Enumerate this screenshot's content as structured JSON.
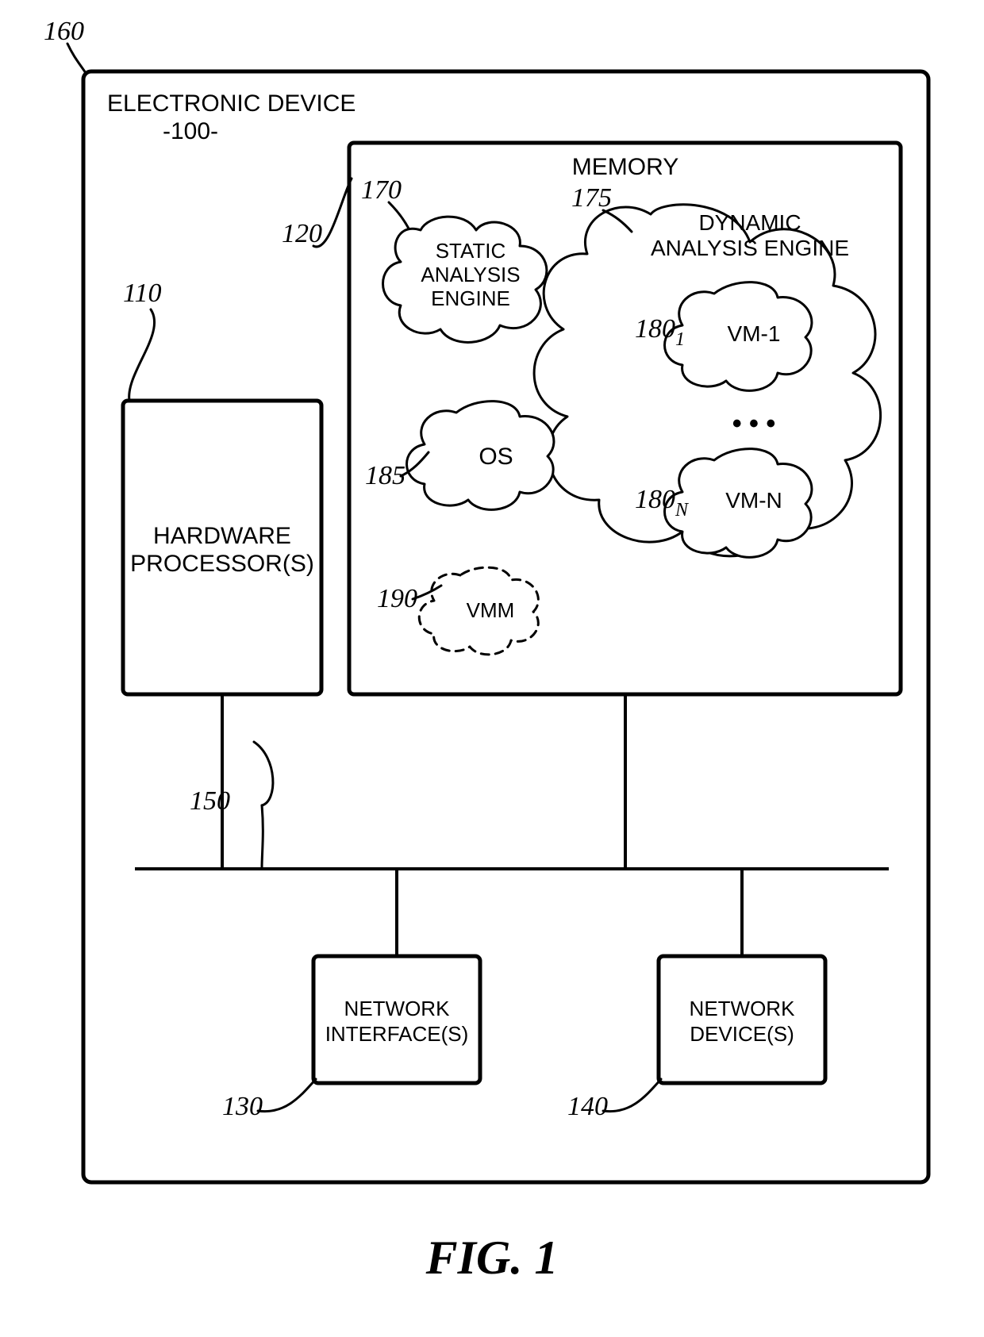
{
  "figure_label": "FIG. 1",
  "outer": {
    "title": "ELECTRONIC DEVICE",
    "subref": "-100-",
    "ref": "160"
  },
  "processor": {
    "label_l1": "HARDWARE",
    "label_l2": "PROCESSOR(S)",
    "ref": "110"
  },
  "memory": {
    "label": "MEMORY",
    "ref": "120"
  },
  "static_eng": {
    "l1": "STATIC",
    "l2": "ANALYSIS",
    "l3": "ENGINE",
    "ref": "170"
  },
  "dynamic_eng": {
    "l1": "DYNAMIC",
    "l2": "ANALYSIS ENGINE",
    "ref": "175"
  },
  "vm1": {
    "label": "VM-1",
    "ref_num": "180",
    "ref_sub": "1"
  },
  "vmn": {
    "label": "VM-N",
    "ref_num": "180",
    "ref_sub": "N"
  },
  "os": {
    "label": "OS",
    "ref": "185"
  },
  "vmm": {
    "label": "VMM",
    "ref": "190"
  },
  "bus": {
    "ref": "150"
  },
  "net_if": {
    "l1": "NETWORK",
    "l2": "INTERFACE(S)",
    "ref": "130"
  },
  "net_dev": {
    "l1": "NETWORK",
    "l2": "DEVICE(S)",
    "ref": "140"
  },
  "ellipsis": "•  •  •"
}
